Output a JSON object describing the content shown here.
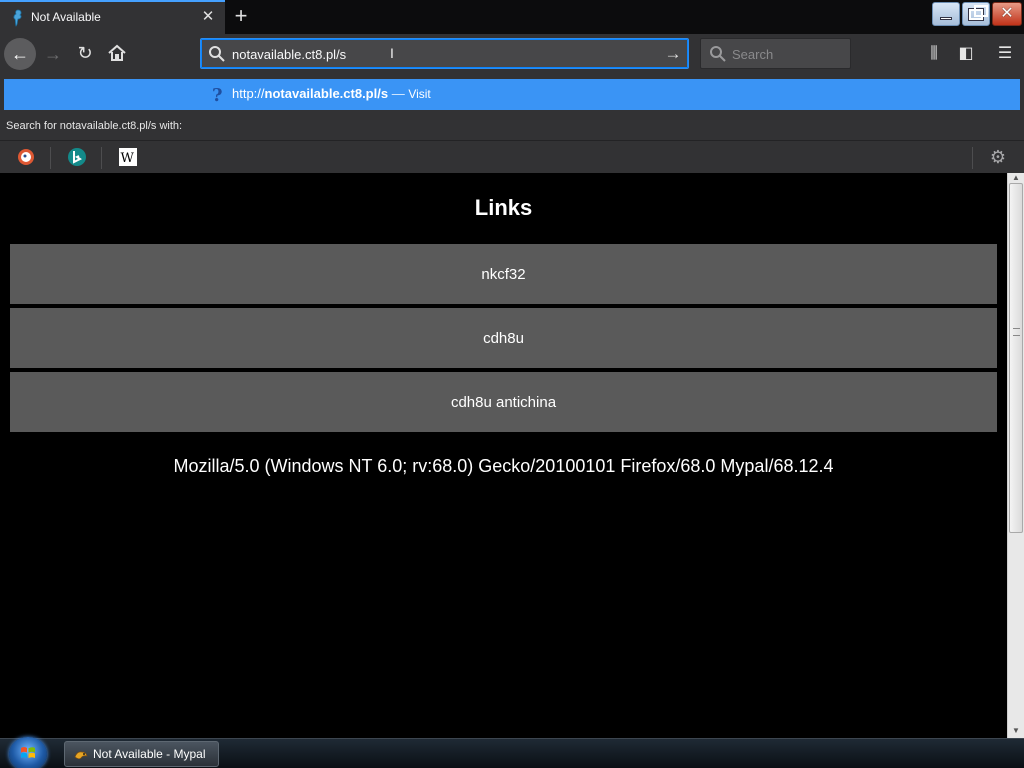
{
  "tab": {
    "title": "Not Available",
    "close_glyph": "✕",
    "new_tab_glyph": "+"
  },
  "window_controls": {
    "close_glyph": "✕"
  },
  "navbar": {
    "back_glyph": "←",
    "forward_glyph": "→",
    "reload_glyph": "↻",
    "url_value": "notavailable.ct8.pl/s",
    "cursor_glyph": "I",
    "go_glyph": "→",
    "search_placeholder": "Search",
    "library_glyph": "⫼",
    "sidebar_glyph": "◧",
    "menu_glyph": "☰"
  },
  "autocomplete": {
    "url_prefix": "http://",
    "url_bold": "notavailable.ct8.pl/s",
    "separator": " — ",
    "action": "Visit",
    "search_for_label": "Search for notavailable.ct8.pl/s with:",
    "engines": [
      "duckduckgo-icon",
      "bing-icon",
      "wikipedia-icon"
    ],
    "settings_glyph": "⚙"
  },
  "page": {
    "heading": "Links",
    "links": [
      "nkcf32",
      "cdh8u",
      "cdh8u antichina"
    ],
    "user_agent": "Mozilla/5.0 (Windows NT 6.0; rv:68.0) Gecko/20100101 Firefox/68.0 Mypal/68.12.4"
  },
  "scrollbar": {
    "up_glyph": "▲",
    "down_glyph": "▼"
  },
  "taskbar": {
    "window_label": "Not Available - Mypal"
  },
  "colors": {
    "accent": "#0a84ff",
    "popup_highlight": "#3a94f5",
    "link_button_bg": "#5a5a5a",
    "page_bg": "#000000"
  }
}
